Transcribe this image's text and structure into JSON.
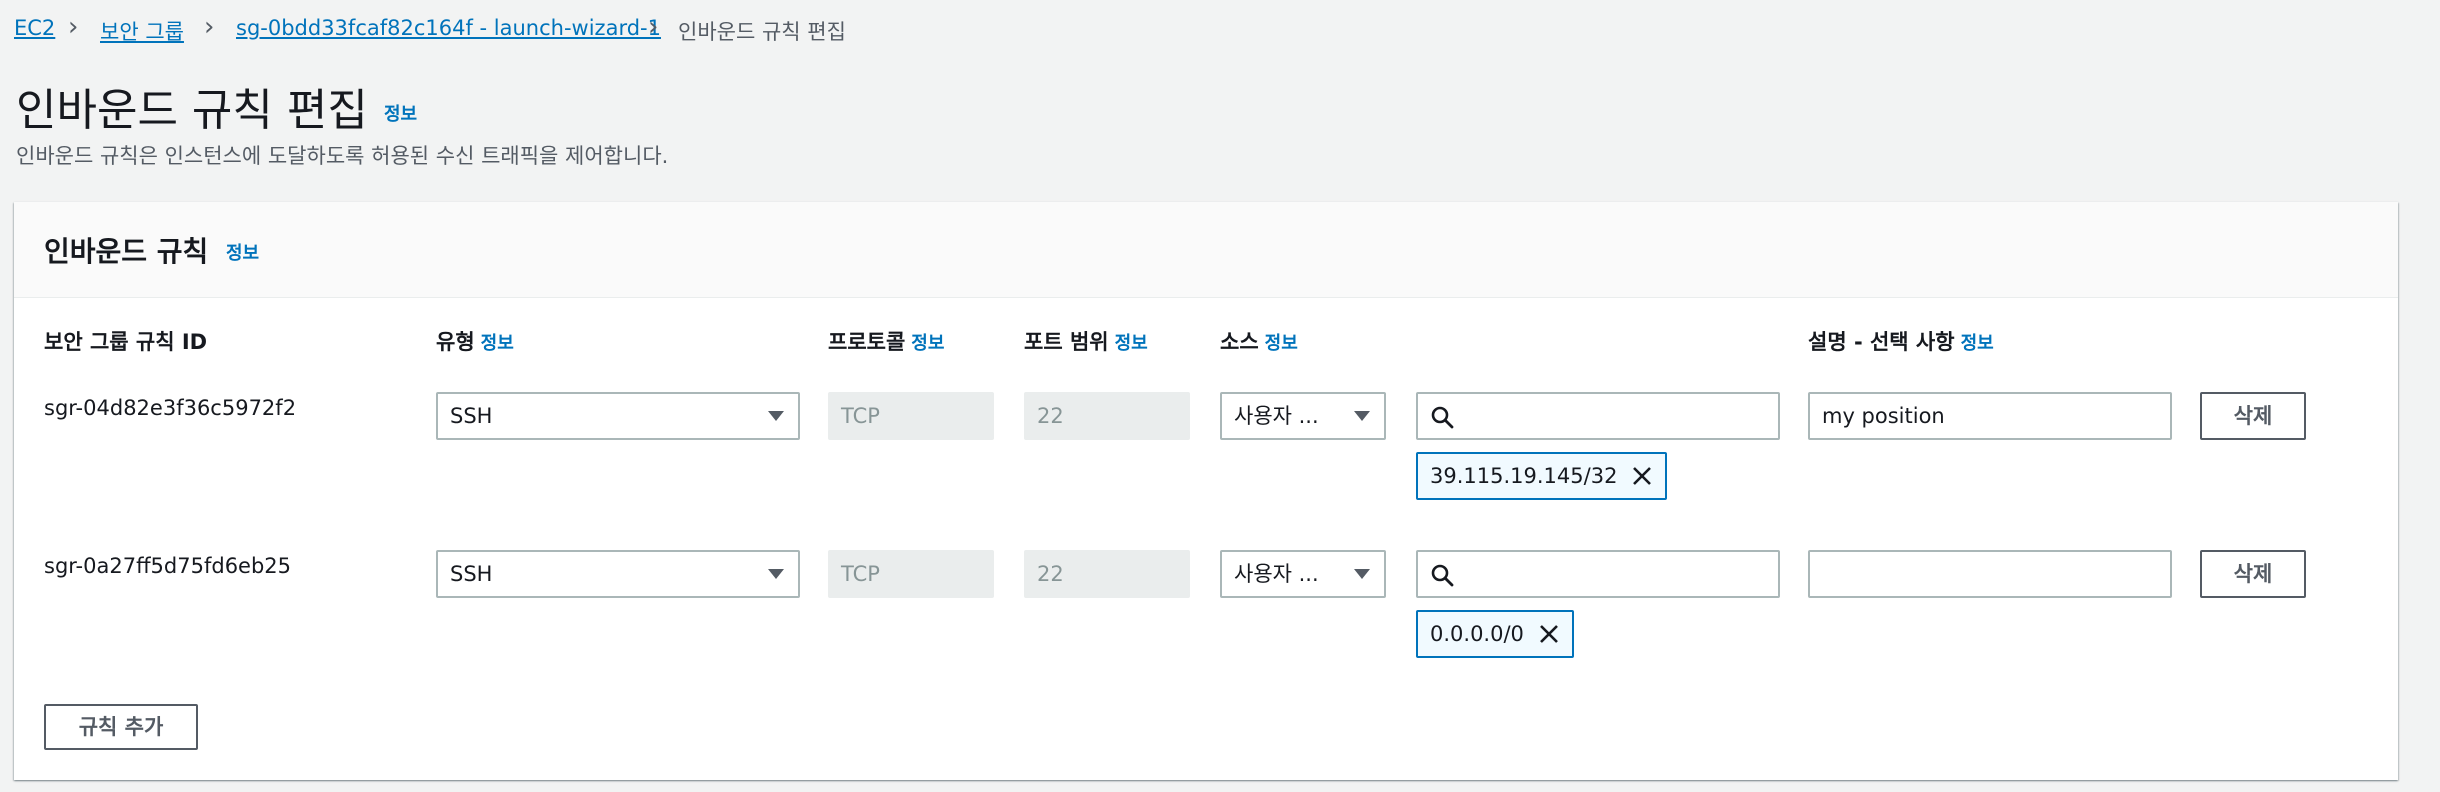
{
  "breadcrumb": {
    "items": [
      {
        "label": "EC2"
      },
      {
        "label": "보안 그룹"
      },
      {
        "label": "sg-0bdd33fcaf82c164f - launch-wizard-1"
      }
    ],
    "current": "인바운드 규칙 편집"
  },
  "page": {
    "title": "인바운드 규칙 편집",
    "info": "정보",
    "description": "인바운드 규칙은 인스턴스에 도달하도록 허용된 수신 트래픽을 제어합니다."
  },
  "panel": {
    "title": "인바운드 규칙",
    "info": "정보",
    "columns": {
      "rule_id": "보안 그룹 규칙 ID",
      "type": "유형",
      "protocol": "프로토콜",
      "port_range": "포트 범위",
      "source": "소스",
      "description": "설명 - 선택 사항",
      "info": "정보"
    },
    "rules": [
      {
        "id": "sgr-04d82e3f36c5972f2",
        "type": "SSH",
        "protocol": "TCP",
        "port": "22",
        "source": "사용자 ...",
        "search_value": "",
        "token": "39.115.19.145/32",
        "description": "my position",
        "delete": "삭제"
      },
      {
        "id": "sgr-0a27ff5d75fd6eb25",
        "type": "SSH",
        "protocol": "TCP",
        "port": "22",
        "source": "사용자 ...",
        "search_value": "",
        "token": "0.0.0.0/0",
        "description": "",
        "delete": "삭제"
      }
    ],
    "add_rule": "규칙 추가"
  },
  "colors": {
    "link": "#0073bb",
    "background": "#f2f3f3",
    "token_border": "#0073bb"
  }
}
